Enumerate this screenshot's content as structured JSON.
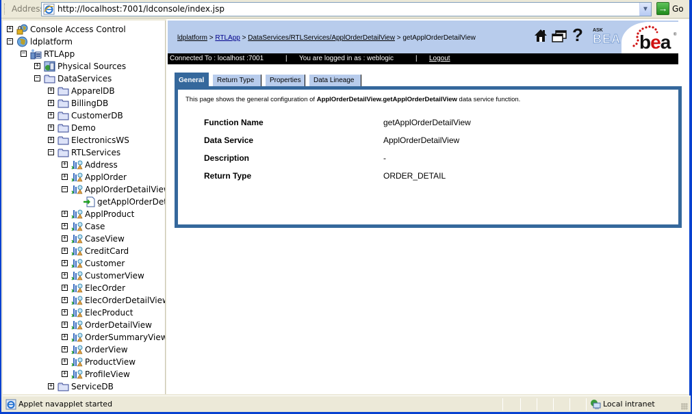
{
  "browser": {
    "address_label": "Address",
    "url": "http://localhost:7001/ldconsole/index.jsp",
    "go_label": "Go"
  },
  "tree": {
    "items": [
      {
        "label": "Console Access Control",
        "level": 0,
        "toggle": "+",
        "icon": "lock-globe-icon"
      },
      {
        "label": "ldplatform",
        "level": 0,
        "toggle": "-",
        "icon": "globe-icon"
      },
      {
        "label": "RTLApp",
        "level": 1,
        "toggle": "-",
        "icon": "application-icon"
      },
      {
        "label": "Physical Sources",
        "level": 2,
        "toggle": "+",
        "icon": "physical-sources-icon"
      },
      {
        "label": "DataServices",
        "level": 2,
        "toggle": "-",
        "icon": "folder-icon"
      },
      {
        "label": "ApparelDB",
        "level": 3,
        "toggle": "+",
        "icon": "folder-icon"
      },
      {
        "label": "BillingDB",
        "level": 3,
        "toggle": "+",
        "icon": "folder-icon"
      },
      {
        "label": "CustomerDB",
        "level": 3,
        "toggle": "+",
        "icon": "folder-icon"
      },
      {
        "label": "Demo",
        "level": 3,
        "toggle": "+",
        "icon": "folder-icon"
      },
      {
        "label": "ElectronicsWS",
        "level": 3,
        "toggle": "+",
        "icon": "folder-icon"
      },
      {
        "label": "RTLServices",
        "level": 3,
        "toggle": "-",
        "icon": "folder-icon"
      },
      {
        "label": "Address",
        "level": 4,
        "toggle": "+",
        "icon": "data-service-icon"
      },
      {
        "label": "ApplOrder",
        "level": 4,
        "toggle": "+",
        "icon": "data-service-icon"
      },
      {
        "label": "ApplOrderDetailView",
        "level": 4,
        "toggle": "-",
        "icon": "data-service-icon"
      },
      {
        "label": "getApplOrderDetailView",
        "level": 5,
        "toggle": "",
        "icon": "function-icon"
      },
      {
        "label": "ApplProduct",
        "level": 4,
        "toggle": "+",
        "icon": "data-service-icon"
      },
      {
        "label": "Case",
        "level": 4,
        "toggle": "+",
        "icon": "data-service-icon"
      },
      {
        "label": "CaseView",
        "level": 4,
        "toggle": "+",
        "icon": "data-service-icon"
      },
      {
        "label": "CreditCard",
        "level": 4,
        "toggle": "+",
        "icon": "data-service-icon"
      },
      {
        "label": "Customer",
        "level": 4,
        "toggle": "+",
        "icon": "data-service-icon"
      },
      {
        "label": "CustomerView",
        "level": 4,
        "toggle": "+",
        "icon": "data-service-icon"
      },
      {
        "label": "ElecOrder",
        "level": 4,
        "toggle": "+",
        "icon": "data-service-icon"
      },
      {
        "label": "ElecOrderDetailView",
        "level": 4,
        "toggle": "+",
        "icon": "data-service-icon"
      },
      {
        "label": "ElecProduct",
        "level": 4,
        "toggle": "+",
        "icon": "data-service-icon"
      },
      {
        "label": "OrderDetailView",
        "level": 4,
        "toggle": "+",
        "icon": "data-service-icon"
      },
      {
        "label": "OrderSummaryView",
        "level": 4,
        "toggle": "+",
        "icon": "data-service-icon"
      },
      {
        "label": "OrderView",
        "level": 4,
        "toggle": "+",
        "icon": "data-service-icon"
      },
      {
        "label": "ProductView",
        "level": 4,
        "toggle": "+",
        "icon": "data-service-icon"
      },
      {
        "label": "ProfileView",
        "level": 4,
        "toggle": "+",
        "icon": "data-service-icon"
      },
      {
        "label": "ServiceDB",
        "level": 3,
        "toggle": "+",
        "icon": "folder-icon"
      }
    ]
  },
  "header": {
    "breadcrumb": [
      {
        "label": "ldplatform",
        "link": true
      },
      {
        "label": "RTLApp",
        "link": true
      },
      {
        "label": "DataServices/RTLServices/ApplOrderDetailView",
        "link": true
      },
      {
        "label": "getApplOrderDetailView",
        "link": false
      }
    ],
    "separator": ">",
    "ask_small": "ASK",
    "ask_big": "BEA",
    "logo_text_b": "b",
    "logo_text_e": "e",
    "logo_text_a": "a",
    "logo_reg": "®"
  },
  "status": {
    "connected_label": "Connected To :  localhost :7001",
    "sep": "|",
    "logged_in": "You are logged in as :  weblogic",
    "logout": "Logout"
  },
  "tabs": [
    {
      "label": "General",
      "active": true
    },
    {
      "label": "Return Type",
      "active": false
    },
    {
      "label": "Properties",
      "active": false
    },
    {
      "label": "Data Lineage",
      "active": false
    }
  ],
  "panel": {
    "desc_prefix": "This page shows the general configuration of ",
    "desc_bold": "ApplOrderDetailView.getApplOrderDetailView",
    "desc_suffix": " data service function.",
    "properties": [
      {
        "label": "Function Name",
        "value": "getApplOrderDetailView"
      },
      {
        "label": "Data Service",
        "value": "ApplOrderDetailView"
      },
      {
        "label": "Description",
        "value": "-"
      },
      {
        "label": "Return Type",
        "value": "ORDER_DETAIL"
      }
    ]
  },
  "statusbar": {
    "message": "Applet navapplet started",
    "zone": "Local intranet"
  },
  "colors": {
    "header_band": "#b8ccec",
    "tab_active": "#35689c",
    "panel_border": "#35689c",
    "window_frame": "#0842D0"
  }
}
